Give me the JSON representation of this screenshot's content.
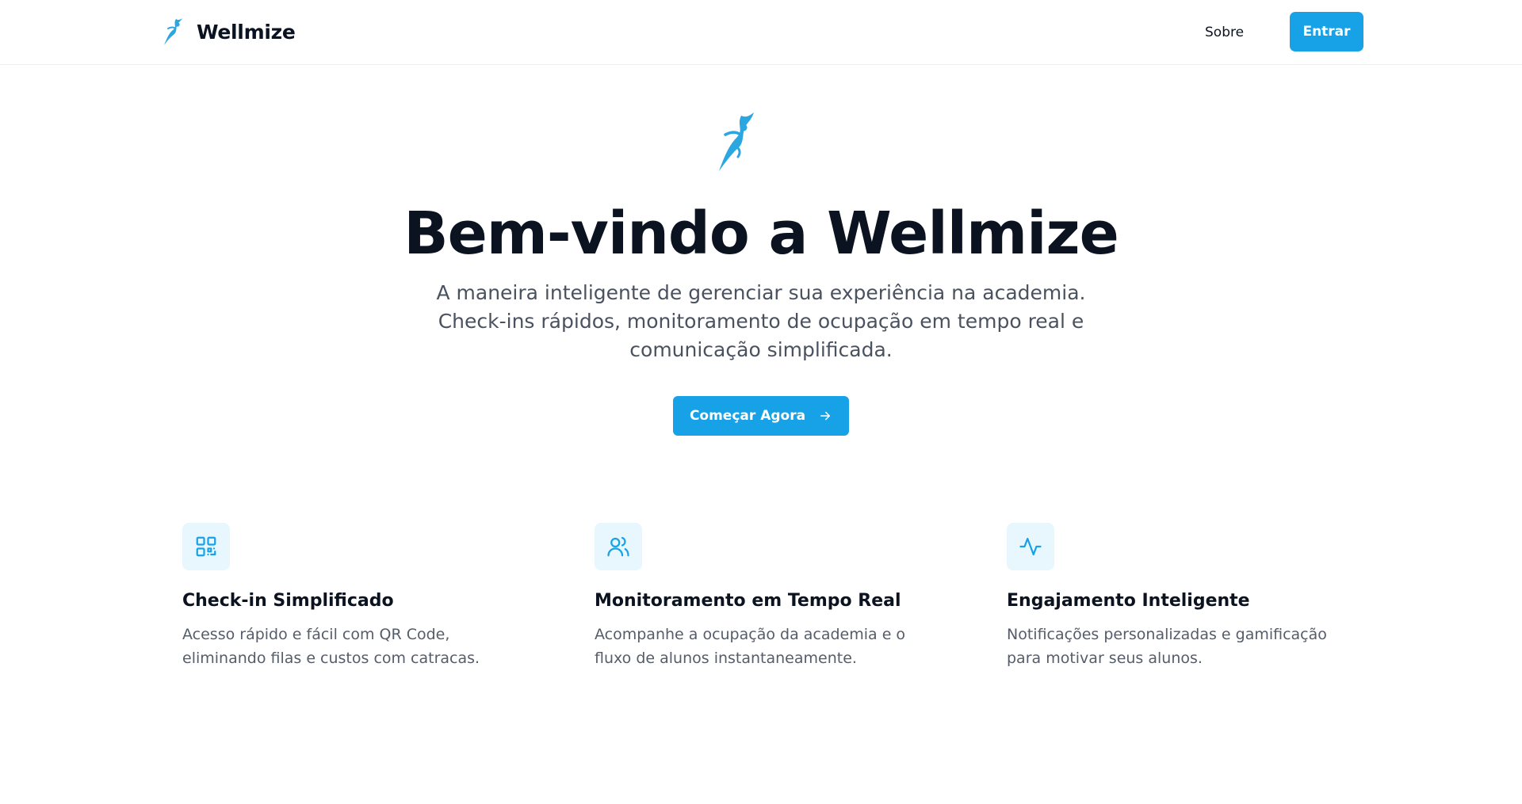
{
  "header": {
    "brand_name": "Wellmize",
    "nav_about": "Sobre",
    "login_button": "Entrar"
  },
  "hero": {
    "title": "Bem-vindo a Wellmize",
    "subtitle": "A maneira inteligente de gerenciar sua experiência na academia. Check-ins rápidos, monitoramento de ocupação em tempo real e comunicação simplificada.",
    "cta_label": "Começar Agora"
  },
  "features": [
    {
      "icon": "qr-code-icon",
      "title": "Check-in Simplificado",
      "description": "Acesso rápido e fácil com QR Code, eliminando filas e custos com catracas."
    },
    {
      "icon": "users-icon",
      "title": "Monitoramento em Tempo Real",
      "description": "Acompanhe a ocupação da academia e o fluxo de alunos instantaneamente."
    },
    {
      "icon": "activity-icon",
      "title": "Engajamento Inteligente",
      "description": "Notificações personalizadas e gamificação para motivar seus alunos."
    }
  ],
  "colors": {
    "accent": "#17a2e8",
    "text_dark": "#0b1220",
    "text_muted": "#4a5260",
    "icon_bg": "#e8f6fd"
  }
}
